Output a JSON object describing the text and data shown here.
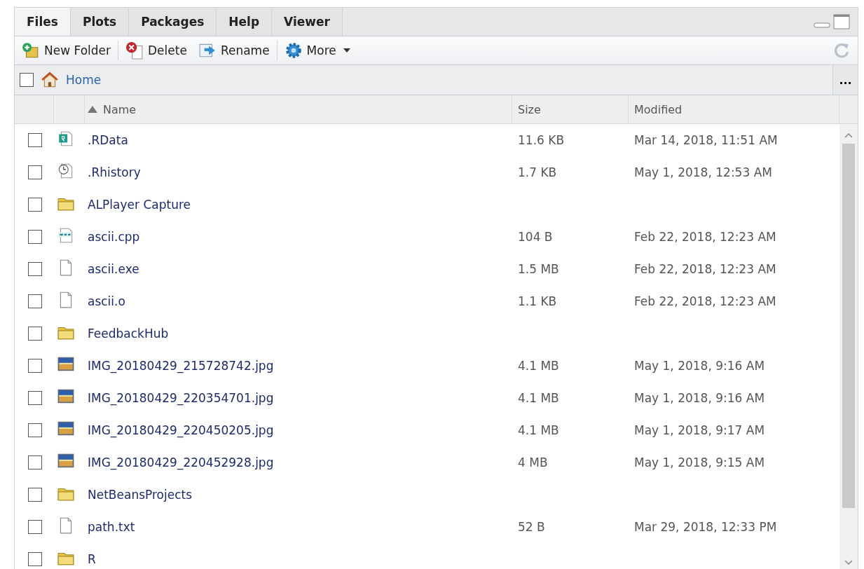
{
  "tabs": [
    {
      "label": "Files",
      "selected": true
    },
    {
      "label": "Plots",
      "selected": false
    },
    {
      "label": "Packages",
      "selected": false
    },
    {
      "label": "Help",
      "selected": false
    },
    {
      "label": "Viewer",
      "selected": false
    }
  ],
  "toolbar": [
    {
      "label": "New Folder",
      "kind": "new-folder"
    },
    {
      "label": "Delete",
      "kind": "delete"
    },
    {
      "label": "Rename",
      "kind": "rename"
    },
    {
      "label": "More",
      "kind": "more"
    }
  ],
  "breadcrumb": {
    "checked": false,
    "label": "Home",
    "more": "..."
  },
  "table": {
    "columns": [
      "Name",
      "Size",
      "Modified"
    ],
    "rows": [
      {
        "kind": "rdata",
        "name": ".RData",
        "size": "11.6 KB",
        "modified": "Mar 14, 2018, 11:51 AM",
        "checked": false
      },
      {
        "kind": "rhistory",
        "name": ".Rhistory",
        "size": "1.7 KB",
        "modified": "May 1, 2018, 12:53 AM",
        "checked": false
      },
      {
        "kind": "folder",
        "name": "ALPlayer Capture",
        "checked": false
      },
      {
        "kind": "cpp",
        "name": "ascii.cpp",
        "size": "104 B",
        "modified": "Feb 22, 2018, 12:23 AM",
        "checked": false
      },
      {
        "kind": "file",
        "name": "ascii.exe",
        "size": "1.5 MB",
        "modified": "Feb 22, 2018, 12:23 AM",
        "checked": false
      },
      {
        "kind": "file",
        "name": "ascii.o",
        "size": "1.1 KB",
        "modified": "Feb 22, 2018, 12:23 AM",
        "checked": false
      },
      {
        "kind": "folder",
        "name": "FeedbackHub",
        "checked": false
      },
      {
        "kind": "image",
        "name": "IMG_20180429_215728742.jpg",
        "size": "4.1 MB",
        "modified": "May 1, 2018, 9:16 AM",
        "checked": false
      },
      {
        "kind": "image",
        "name": "IMG_20180429_220354701.jpg",
        "size": "4.1 MB",
        "modified": "May 1, 2018, 9:16 AM",
        "checked": false
      },
      {
        "kind": "image",
        "name": "IMG_20180429_220450205.jpg",
        "size": "4.1 MB",
        "modified": "May 1, 2018, 9:17 AM",
        "checked": false
      },
      {
        "kind": "image",
        "name": "IMG_20180429_220452928.jpg",
        "size": "4 MB",
        "modified": "May 1, 2018, 9:15 AM",
        "checked": false
      },
      {
        "kind": "folder",
        "name": "NetBeansProjects",
        "checked": false
      },
      {
        "kind": "file",
        "name": "path.txt",
        "size": "52 B",
        "modified": "Mar 29, 2018, 12:33 PM",
        "checked": false
      },
      {
        "kind": "folder",
        "name": "R",
        "checked": false
      }
    ]
  }
}
